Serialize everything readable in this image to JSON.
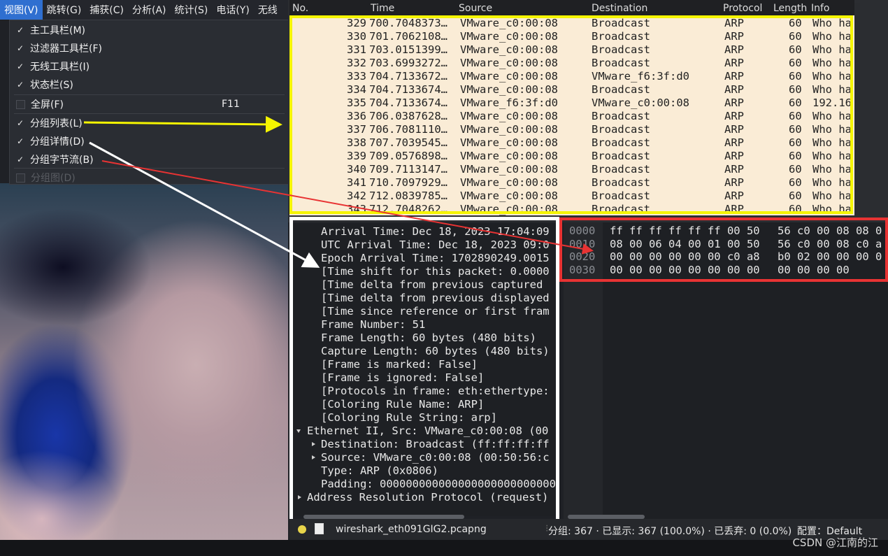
{
  "menubar": {
    "items": [
      "视图(V)",
      "跳转(G)",
      "捕获(C)",
      "分析(A)",
      "统计(S)",
      "电话(Y)",
      "无线"
    ]
  },
  "view_menu": {
    "items": [
      {
        "label": "主工具栏(M)",
        "checked": true
      },
      {
        "label": "过滤器工具栏(F)",
        "checked": true
      },
      {
        "label": "无线工具栏(I)",
        "checked": true
      },
      {
        "label": "状态栏(S)",
        "checked": true
      },
      {
        "label": "全屏(F)",
        "checked": false,
        "shortcut": "F11"
      },
      {
        "label": "分组列表(L)",
        "checked": true
      },
      {
        "label": "分组详情(D)",
        "checked": true
      },
      {
        "label": "分组字节流(B)",
        "checked": true
      },
      {
        "label": "分组图(D)",
        "checked": false,
        "disabled": true
      }
    ]
  },
  "packet_list": {
    "columns": [
      "No.",
      "Time",
      "Source",
      "Destination",
      "Protocol",
      "Length",
      "Info"
    ],
    "rows": [
      [
        "329",
        "700.7048373…",
        "VMware_c0:00:08",
        "Broadcast",
        "ARP",
        "60",
        "Who ha"
      ],
      [
        "330",
        "701.7062108…",
        "VMware_c0:00:08",
        "Broadcast",
        "ARP",
        "60",
        "Who ha"
      ],
      [
        "331",
        "703.0151399…",
        "VMware_c0:00:08",
        "Broadcast",
        "ARP",
        "60",
        "Who ha"
      ],
      [
        "332",
        "703.6993272…",
        "VMware_c0:00:08",
        "Broadcast",
        "ARP",
        "60",
        "Who ha"
      ],
      [
        "333",
        "704.7133672…",
        "VMware_c0:00:08",
        "VMware_f6:3f:d0",
        "ARP",
        "60",
        "Who ha"
      ],
      [
        "334",
        "704.7133674…",
        "VMware_c0:00:08",
        "Broadcast",
        "ARP",
        "60",
        "Who ha"
      ],
      [
        "335",
        "704.7133674…",
        "VMware_f6:3f:d0",
        "VMware_c0:00:08",
        "ARP",
        "60",
        "192.16"
      ],
      [
        "336",
        "706.0387628…",
        "VMware_c0:00:08",
        "Broadcast",
        "ARP",
        "60",
        "Who ha"
      ],
      [
        "337",
        "706.7081110…",
        "VMware_c0:00:08",
        "Broadcast",
        "ARP",
        "60",
        "Who ha"
      ],
      [
        "338",
        "707.7039545…",
        "VMware_c0:00:08",
        "Broadcast",
        "ARP",
        "60",
        "Who ha"
      ],
      [
        "339",
        "709.0576898…",
        "VMware_c0:00:08",
        "Broadcast",
        "ARP",
        "60",
        "Who ha"
      ],
      [
        "340",
        "709.7113147…",
        "VMware_c0:00:08",
        "Broadcast",
        "ARP",
        "60",
        "Who ha"
      ],
      [
        "341",
        "710.7097929…",
        "VMware_c0:00:08",
        "Broadcast",
        "ARP",
        "60",
        "Who ha"
      ],
      [
        "342",
        "712.0839785…",
        "VMware_c0:00:08",
        "Broadcast",
        "ARP",
        "60",
        "Who ha"
      ],
      [
        "343",
        "712.7048262…",
        "VMware_c0:00:08",
        "Broadcast",
        "ARP",
        "60",
        "Who ha"
      ]
    ]
  },
  "packet_details": {
    "lines": [
      {
        "indent": 2,
        "text": "Arrival Time: Dec 18, 2023 17:04:09"
      },
      {
        "indent": 2,
        "text": "UTC Arrival Time: Dec 18, 2023 09:0"
      },
      {
        "indent": 2,
        "text": "Epoch Arrival Time: 1702890249.0015"
      },
      {
        "indent": 2,
        "text": "[Time shift for this packet: 0.0000"
      },
      {
        "indent": 2,
        "text": "[Time delta from previous captured"
      },
      {
        "indent": 2,
        "text": "[Time delta from previous displayed"
      },
      {
        "indent": 2,
        "text": "[Time since reference or first fram"
      },
      {
        "indent": 2,
        "text": "Frame Number: 51"
      },
      {
        "indent": 2,
        "text": "Frame Length: 60 bytes (480 bits)"
      },
      {
        "indent": 2,
        "text": "Capture Length: 60 bytes (480 bits)"
      },
      {
        "indent": 2,
        "text": "[Frame is marked: False]"
      },
      {
        "indent": 2,
        "text": "[Frame is ignored: False]"
      },
      {
        "indent": 2,
        "text": "[Protocols in frame: eth:ethertype:"
      },
      {
        "indent": 2,
        "text": "[Coloring Rule Name: ARP]"
      },
      {
        "indent": 2,
        "text": "[Coloring Rule String: arp]"
      },
      {
        "indent": 1,
        "text": "Ethernet II, Src: VMware_c0:00:08 (00",
        "toggle": "expanded"
      },
      {
        "indent": 2,
        "text": "Destination: Broadcast (ff:ff:ff:ff",
        "toggle": "collapsed"
      },
      {
        "indent": 2,
        "text": "Source: VMware_c0:00:08 (00:50:56:c",
        "toggle": "collapsed"
      },
      {
        "indent": 2,
        "text": "Type: ARP (0x0806)"
      },
      {
        "indent": 2,
        "text": "Padding: 000000000000000000000000000"
      },
      {
        "indent": 1,
        "text": "Address Resolution Protocol (request)",
        "toggle": "collapsed"
      }
    ]
  },
  "packet_bytes": {
    "lines": [
      {
        "offset": "0000",
        "hex1": "ff ff ff ff ff ff 00 50",
        "hex2": "56 c0 00 08 08 0"
      },
      {
        "offset": "0010",
        "hex1": "08 00 06 04 00 01 00 50",
        "hex2": "56 c0 00 08 c0 a"
      },
      {
        "offset": "0020",
        "hex1": "00 00 00 00 00 00 c0 a8",
        "hex2": "b0 02 00 00 00 0"
      },
      {
        "offset": "0030",
        "hex1": "00 00 00 00 00 00 00 00",
        "hex2": "00 00 00 00"
      }
    ]
  },
  "statusbar": {
    "filename": "wireshark_eth091GIG2.pcapng",
    "counts": "分组: 367 · 已显示: 367 (100.0%) · 已丢弃: 0 (0.0%)",
    "profile": "配置：Default"
  },
  "watermark": "CSDN @江南的江",
  "colors": {
    "annotation_yellow": "#f5f500",
    "annotation_white": "#ffffff",
    "annotation_red": "#e83333",
    "packet_row_bg": "#faecd6"
  }
}
